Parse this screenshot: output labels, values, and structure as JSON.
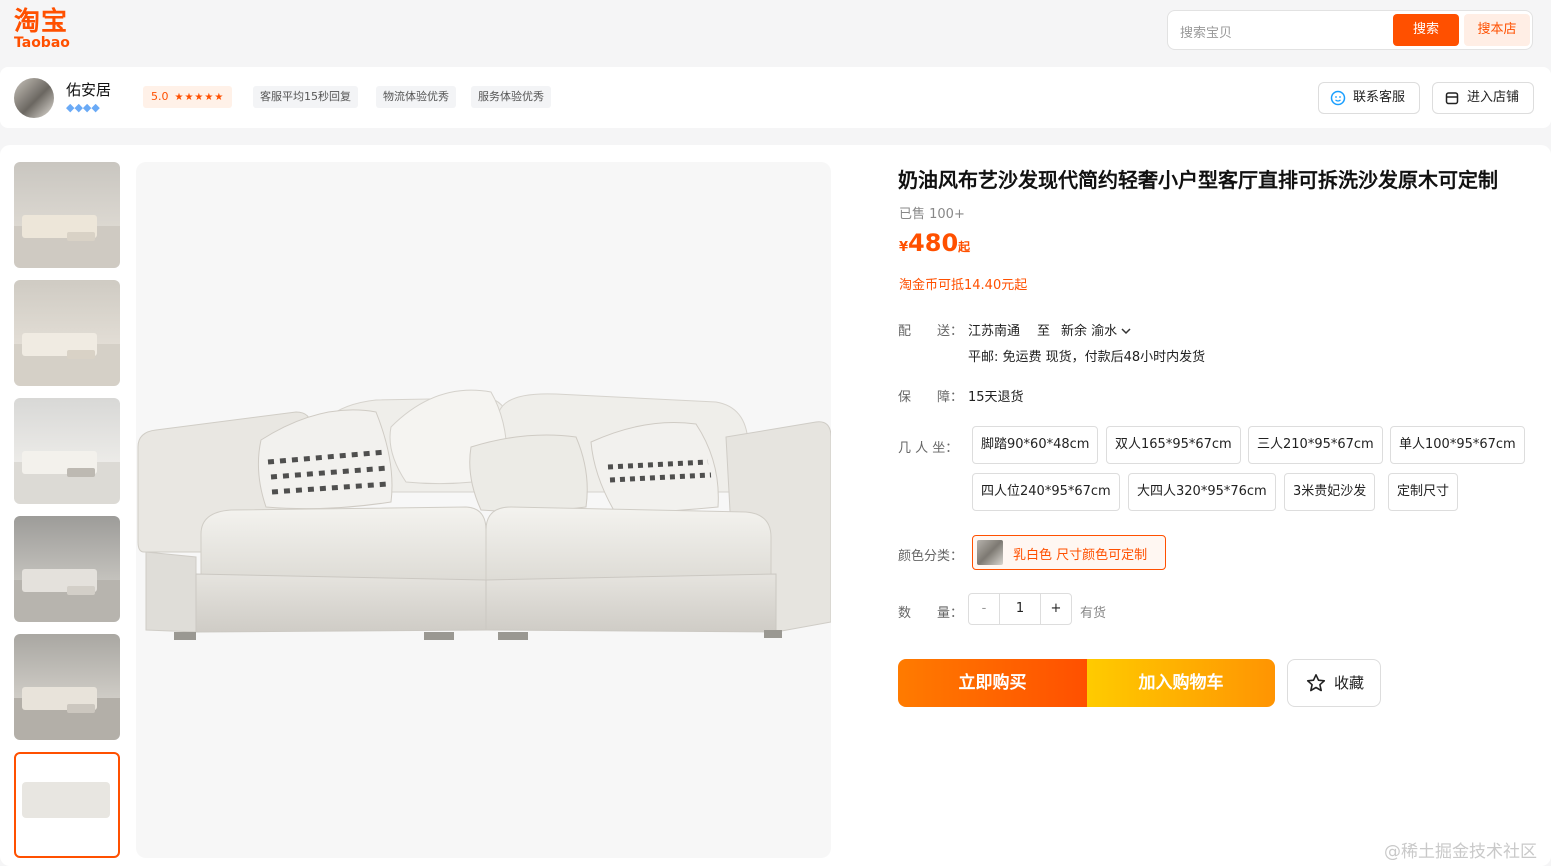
{
  "header": {
    "logo_cn": "淘宝",
    "logo_en": "Taobao",
    "search_placeholder": "搜索宝贝",
    "search_button": "搜索",
    "search_store_button": "搜本店"
  },
  "shop": {
    "name": "佑安居",
    "diamonds": "◆◆◆◆",
    "rating": "5.0",
    "stars": "★★★★★",
    "tags": [
      "客服平均15秒回复",
      "物流体验优秀",
      "服务体验优秀"
    ],
    "contact_button": "联系客服",
    "enter_store_button": "进入店铺"
  },
  "product": {
    "title": "奶油风布艺沙发现代简约轻奢小户型客厅直排可拆洗沙发原木可定制",
    "sold": "已售 100+",
    "price_currency": "¥",
    "price": "480",
    "price_suffix": "起",
    "coin_text": "淘金币可抵14.40元起",
    "delivery_label": "配　　送：",
    "delivery_from": "江苏南通",
    "delivery_to_word": "至",
    "delivery_to": "新余 渝水",
    "delivery_detail": "平邮: 免运费  现货，付款后48小时内发货",
    "guarantee_label": "保　　障：",
    "guarantee": "15天退货",
    "seat_label": "几 人 坐：",
    "seat_options": [
      "脚踏90*60*48cm",
      "双人165*95*67cm",
      "三人210*95*67cm",
      "单人100*95*67cm",
      "四人位240*95*67cm",
      "大四人320*95*76cm",
      "3米贵妃沙发",
      "定制尺寸"
    ],
    "color_label": "颜色分类：",
    "color_option": "乳白色 尺寸颜色可定制",
    "qty_label": "数　　量：",
    "qty_minus": "-",
    "qty_value": "1",
    "qty_plus": "+",
    "stock": "有货",
    "buy_now": "立即购买",
    "add_cart": "加入购物车",
    "favorite": "收藏"
  },
  "watermark": "@稀土掘金技术社区",
  "colors": {
    "accent": "#ff5000",
    "cart_yellow": "#ffb400"
  }
}
